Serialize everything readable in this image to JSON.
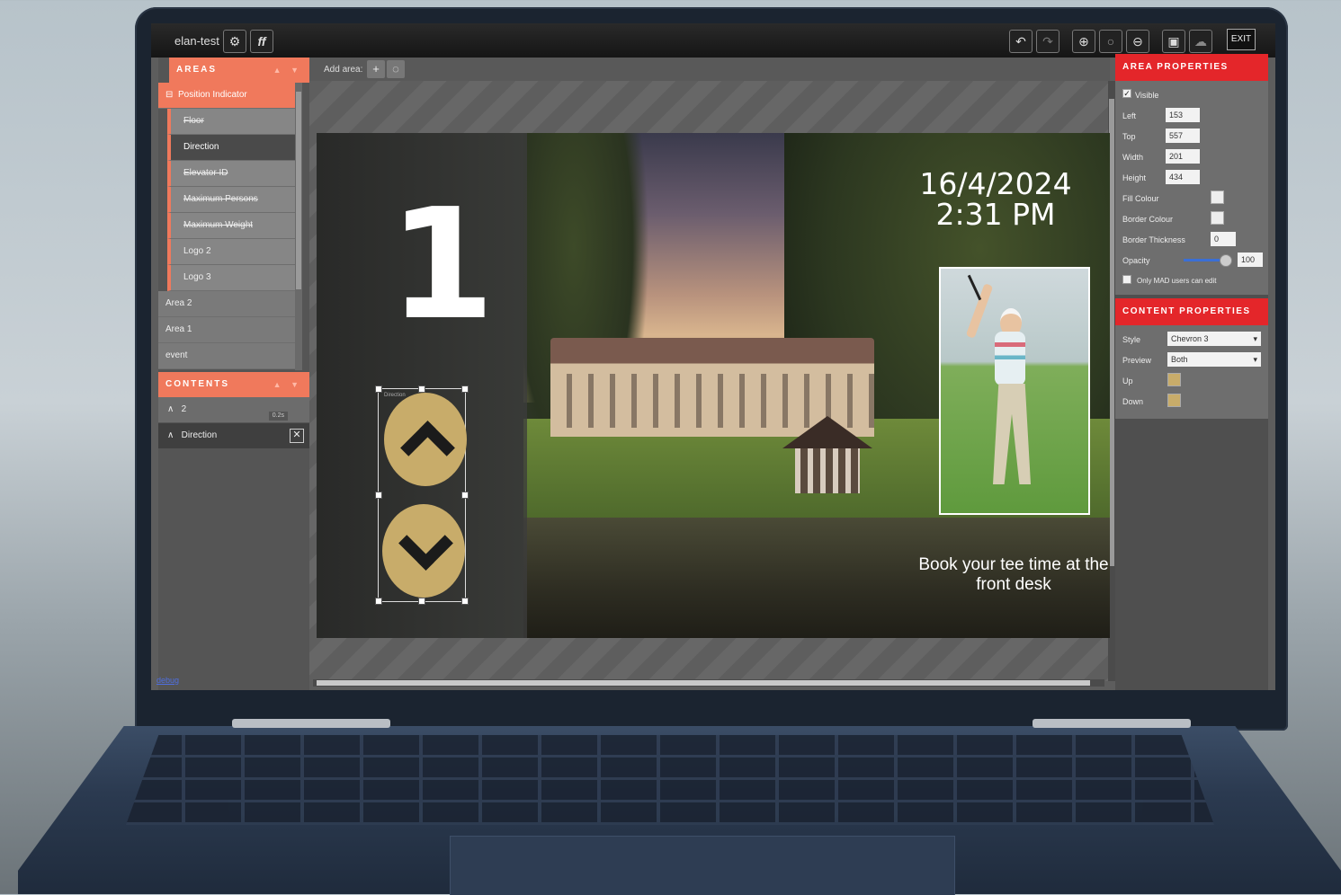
{
  "app": {
    "title": "elan-test",
    "toolbar": {
      "settings_icon": "gear-icon",
      "font_btn": "ff",
      "undo_icon": "undo-icon",
      "redo_icon": "redo-icon",
      "zoom_in_icon": "zoom-in-icon",
      "zoom_reset_icon": "zoom-reset-icon",
      "zoom_out_icon": "zoom-out-icon",
      "save_icon": "save-icon",
      "publish_icon": "cloud-upload-icon",
      "exit_label": "EXIT"
    }
  },
  "areas_panel": {
    "heading": "AREAS",
    "items": [
      {
        "label": "Position Indicator"
      },
      {
        "label": "Floor"
      },
      {
        "label": "Direction"
      },
      {
        "label": "Elevator ID"
      },
      {
        "label": "Maximum Persons"
      },
      {
        "label": "Maximum Weight"
      },
      {
        "label": "Logo 2"
      },
      {
        "label": "Logo 3"
      },
      {
        "label": "Area 2"
      },
      {
        "label": "Area 1"
      },
      {
        "label": "event"
      }
    ]
  },
  "contents_panel": {
    "heading": "CONTENTS",
    "items": [
      {
        "label": "2",
        "badge": "0.2s"
      },
      {
        "label": "Direction"
      }
    ]
  },
  "debug_link": "debug",
  "add_area": {
    "label": "Add area:"
  },
  "canvas": {
    "floor_number": "1",
    "direction_tag": "Direction",
    "date": "16/4/2024",
    "time": "2:31 PM",
    "promo_text": "Book your tee time at the front desk"
  },
  "area_properties": {
    "heading": "AREA PROPERTIES",
    "visible_label": "Visible",
    "left_label": "Left",
    "left": "153",
    "top_label": "Top",
    "top": "557",
    "width_label": "Width",
    "width": "201",
    "height_label": "Height",
    "height": "434",
    "fill_label": "Fill Colour",
    "border_colour_label": "Border Colour",
    "border_thickness_label": "Border Thickness",
    "border_thickness": "0",
    "opacity_label": "Opacity",
    "opacity": "100",
    "mad_label": "Only MAD users can edit"
  },
  "content_properties": {
    "heading": "CONTENT PROPERTIES",
    "style_label": "Style",
    "style": "Chevron 3",
    "preview_label": "Preview",
    "preview": "Both",
    "up_label": "Up",
    "down_label": "Down",
    "swatch_color": "#c8ac6a"
  },
  "colors": {
    "accent": "#f0795c",
    "header_red": "#e4262a",
    "gold": "#c8ac6a"
  }
}
